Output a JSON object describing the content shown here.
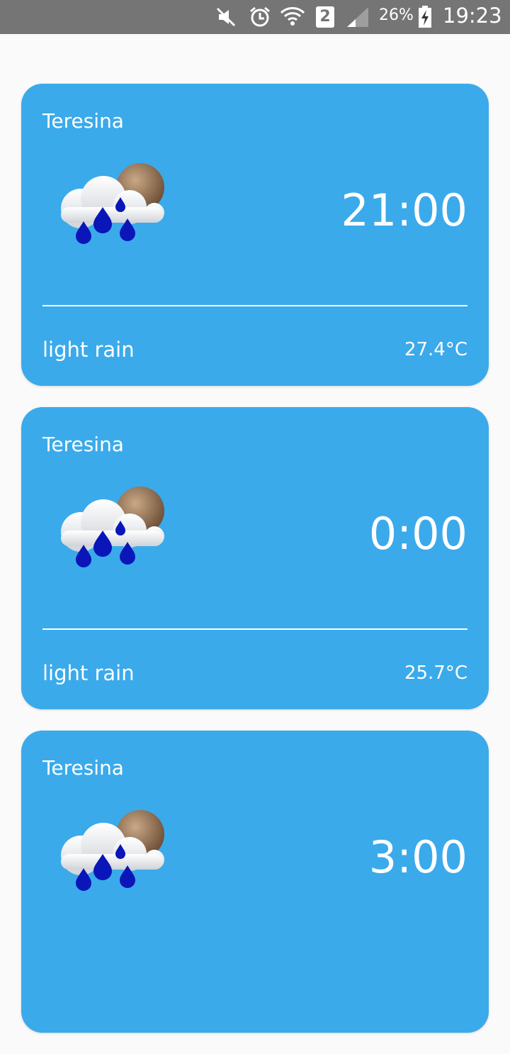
{
  "status_bar": {
    "battery": "26%",
    "clock": "19:23",
    "sim": "2",
    "icons": [
      "mute-icon",
      "alarm-icon",
      "wifi-icon",
      "sim-icon",
      "signal-icon",
      "battery-charging-icon"
    ]
  },
  "forecasts": [
    {
      "city": "Teresina",
      "time": "21:00",
      "description": "light rain",
      "temperature": "27.4°C",
      "icon": "light-rain-icon"
    },
    {
      "city": "Teresina",
      "time": "0:00",
      "description": "light rain",
      "temperature": "25.7°C",
      "icon": "light-rain-icon"
    },
    {
      "city": "Teresina",
      "time": "3:00",
      "description": "",
      "temperature": "",
      "icon": "light-rain-icon"
    }
  ],
  "colors": {
    "card": "#3aaaeb",
    "background": "#fafafa",
    "status_bar": "#757575"
  }
}
